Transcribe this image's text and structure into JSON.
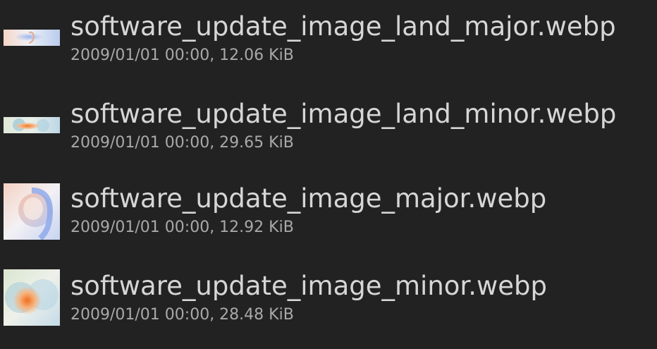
{
  "files": [
    {
      "name": "software_update_image_land_major.webp",
      "meta": "2009/01/01 00:00, 12.06 KiB",
      "thumbnail_icon": "landscape-major-thumbnail"
    },
    {
      "name": "software_update_image_land_minor.webp",
      "meta": "2009/01/01 00:00, 29.65 KiB",
      "thumbnail_icon": "landscape-minor-thumbnail"
    },
    {
      "name": "software_update_image_major.webp",
      "meta": "2009/01/01 00:00, 12.92 KiB",
      "thumbnail_icon": "portrait-major-thumbnail"
    },
    {
      "name": "software_update_image_minor.webp",
      "meta": "2009/01/01 00:00, 28.48 KiB",
      "thumbnail_icon": "portrait-minor-thumbnail"
    }
  ],
  "colors": {
    "background": "#222222",
    "name_text": "#d6d6d6",
    "meta_text": "#a9a9a9"
  }
}
